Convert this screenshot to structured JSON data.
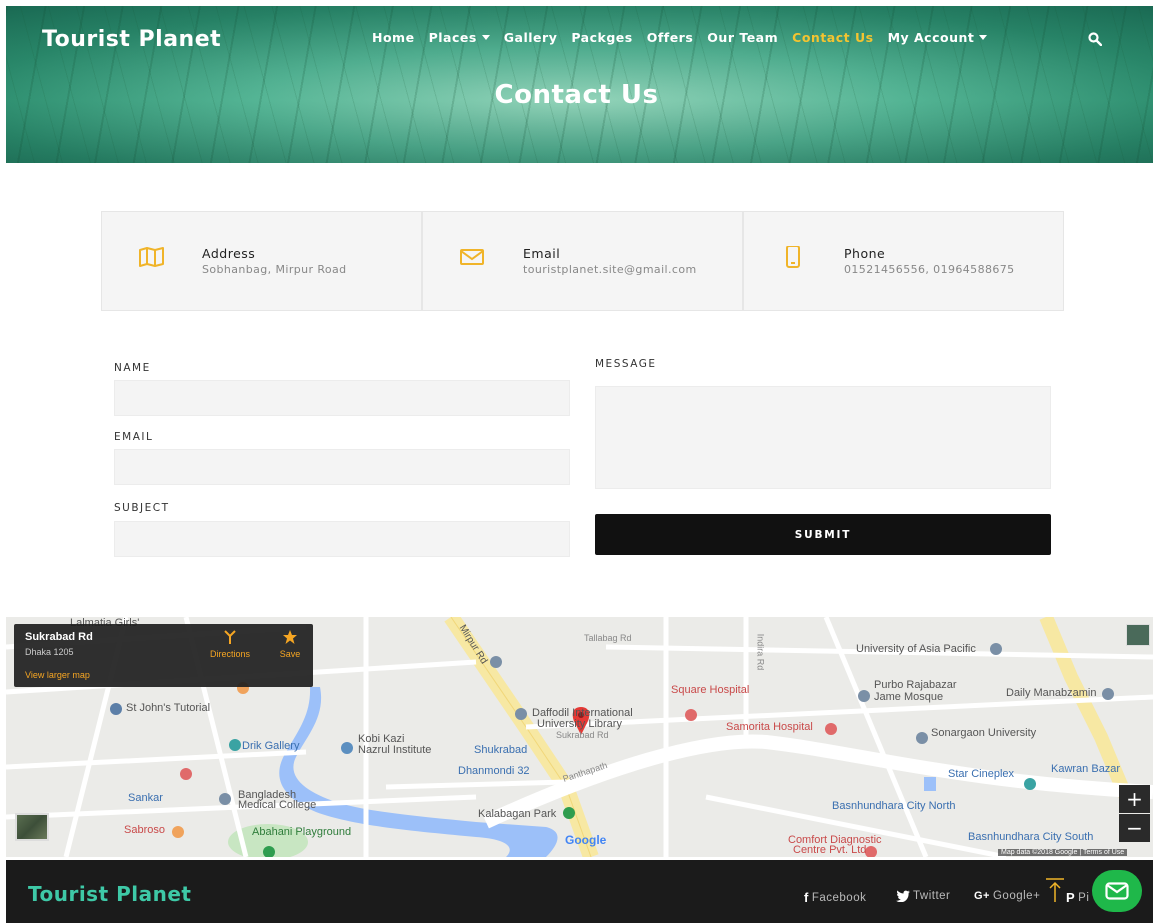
{
  "header": {
    "brand": "Tourist Planet",
    "nav": [
      {
        "label": "Home",
        "dropdown": false,
        "active": false
      },
      {
        "label": "Places",
        "dropdown": true,
        "active": false
      },
      {
        "label": "Gallery",
        "dropdown": false,
        "active": false
      },
      {
        "label": "Packges",
        "dropdown": false,
        "active": false
      },
      {
        "label": "Offers",
        "dropdown": false,
        "active": false
      },
      {
        "label": "Our Team",
        "dropdown": false,
        "active": false
      },
      {
        "label": "Contact Us",
        "dropdown": false,
        "active": true
      },
      {
        "label": "My Account",
        "dropdown": true,
        "active": false
      }
    ],
    "page_title": "Contact Us"
  },
  "contact_info": [
    {
      "icon": "map-icon",
      "title": "Address",
      "value": "Sobhanbag, Mirpur Road"
    },
    {
      "icon": "envelope-icon",
      "title": "Email",
      "value": "touristplanet.site@gmail.com"
    },
    {
      "icon": "mobile-icon",
      "title": "Phone",
      "value": "01521456556, 01964588675"
    }
  ],
  "form": {
    "name_label": "NAME",
    "email_label": "EMAIL",
    "subject_label": "SUBJECT",
    "message_label": "MESSAGE",
    "name_value": "",
    "email_value": "",
    "subject_value": "",
    "message_value": "",
    "submit_label": "SUBMIT"
  },
  "map": {
    "card": {
      "title": "Sukrabad Rd",
      "subtitle": "Dhaka 1205",
      "link": "View larger map",
      "directions": "Directions",
      "save": "Save"
    },
    "labels": {
      "lalmatia": "Lalmatia Girls'",
      "mirpur_rd": "Mirpur Rd",
      "tallabag": "Tallabag Rd",
      "indira": "Indira Rd",
      "asia_pacific": "University of Asia Pacific",
      "purbo": "Purbo Rajabazar",
      "jame": "Jame Mosque",
      "daily": "Daily Manabzamin",
      "square": "Square Hospital",
      "st_johns": "St John's Tutorial",
      "daffodil": "Daffodil International",
      "daffodil2": "University Library",
      "sukrabad_rd": "Sukrabad Rd",
      "samorita": "Samorita Hospital",
      "sonargaon": "Sonargaon University",
      "drik": "Drik Gallery",
      "kobi1": "Kobi Kazi",
      "kobi2": "Nazrul Institute",
      "shukrabad": "Shukrabad",
      "dhanmondi32": "Dhanmondi 32",
      "panthapath": "Panthapath",
      "star": "Star Cineplex",
      "kawran": "Kawran Bazar",
      "sankar": "Sankar",
      "bmc1": "Bangladesh",
      "bmc2": "Medical College",
      "kalabagan": "Kalabagan Park",
      "basun_north": "Basnhundhara City North",
      "basun_south": "Basnhundhara City South",
      "sabroso": "Sabroso",
      "abahani": "Abahani Playground",
      "comfort1": "Comfort Diagnostic",
      "comfort2": "Centre Pvt. Ltd",
      "google": "Google",
      "attribution": "Map data ©2018 Google | Terms of Use",
      "zoom_in": "+",
      "zoom_out": "−"
    }
  },
  "footer": {
    "brand": "Tourist Planet",
    "social": [
      {
        "glyph": "f",
        "label": "Facebook",
        "icon": "facebook-icon"
      },
      {
        "glyph": "🐦",
        "label": "Twitter",
        "icon": "twitter-icon"
      },
      {
        "glyph": "G+",
        "label": "Google+",
        "icon": "google-plus-icon"
      },
      {
        "glyph": "P",
        "label": "Pi",
        "icon": "pinterest-icon"
      }
    ]
  },
  "colors": {
    "accent": "#f4c430",
    "footer_brand": "#3ec9a7",
    "icon_gold": "#f0b429",
    "message_button": "#1fb84a"
  }
}
